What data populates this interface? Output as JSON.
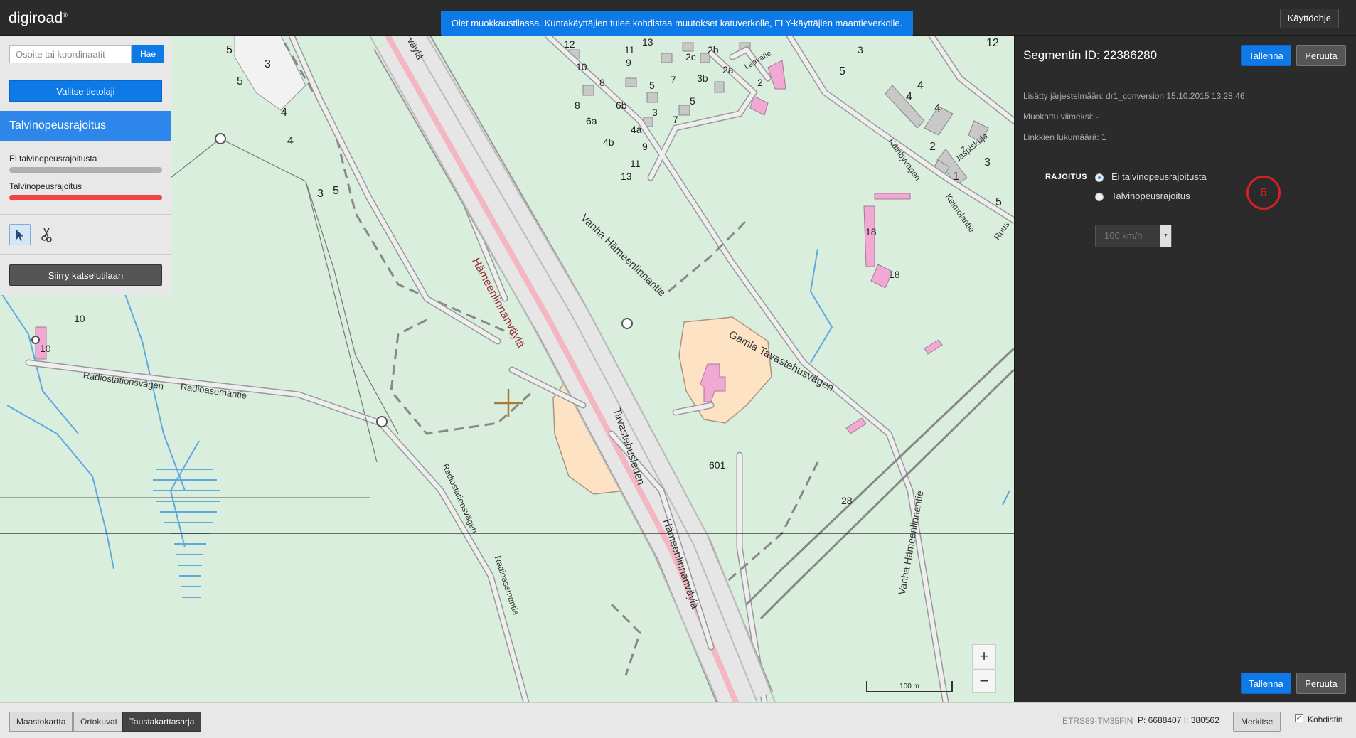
{
  "app": {
    "logo": "digiroad",
    "logo_mark": "®"
  },
  "header": {
    "notice": "Olet muokkaustilassa. Kuntakäyttäjien tulee kohdistaa muutokset katuverkolle, ELY-käyttäjien maantieverkolle.",
    "help_label": "Käyttöohje"
  },
  "search": {
    "placeholder": "Osoite tai koordinaatit",
    "button_label": "Hae"
  },
  "layer_select_label": "Valitse tietolaji",
  "layer": {
    "title": "Talvinopeusrajoitus",
    "legend": [
      {
        "label": "Ei talvinopeusrajoitusta",
        "color": "#b0b0b0"
      },
      {
        "label": "Talvinopeusrajoitus",
        "color": "#ee4444"
      }
    ]
  },
  "tools": {
    "select": "select-icon",
    "cut": "scissors-icon"
  },
  "view_mode_label": "Siirry katselutilaan",
  "segment": {
    "title": "Segmentin ID: 22386280",
    "save_label": "Tallenna",
    "cancel_label": "Peruuta",
    "added": "Lisätty järjestelmään: dr1_conversion 15.10.2015 13:28:46",
    "modified": "Muokattu viimeksi: -",
    "links": "Linkkien lukumäärä: 1",
    "restriction_label": "RAJOITUS",
    "options": [
      "Ei talvinopeusrajoitusta",
      "Talvinopeusrajoitus"
    ],
    "selected_option": 0,
    "speed_value": "100 km/h",
    "step_marker": "6"
  },
  "map": {
    "zoom_in": "+",
    "zoom_out": "−",
    "scale_label": "100 m",
    "street_labels": {
      "hameenlinnanvayla": "Hämeenlinnanväylä",
      "vanha_hameenlinnantie": "Vanha Hämeenlinnantie",
      "gamla_tavastehusvagen": "Gamla Tavastehusvägen",
      "tavastehusleden": "Tavastehusleden",
      "hameenlinnanvayla2": "Hämeenlinnanväylä",
      "radiostationsvagen": "Radiostationsvägen",
      "radioasemantie": "Radioasemantie",
      "radiostationsvagen2": "Radiostationsvägen",
      "radioasemantie2": "Radioasemantie",
      "kainbyvagen": "Käinbyvägen",
      "keimolantie": "Keimolantie",
      "jaspiskuja": "Jaspiskuja",
      "laavatie": "Laavatie",
      "vanha_hameenlinnantie2": "Vanha Hämeenlinnantie",
      "vayla_top": "väylä",
      "ruus": "Ruus"
    },
    "numbers": {
      "n601": "601",
      "n28": "28",
      "n18a": "18",
      "n18b": "18",
      "n10a": "10",
      "n10b": "10",
      "n3": "3",
      "n5a": "5",
      "n5b": "5",
      "n4a": "4",
      "n4b": "4",
      "n3b": "3",
      "n5c": "5",
      "n12a": "12",
      "n13": "13",
      "n10c": "10",
      "n11": "11",
      "n9": "9",
      "n2c": "2c",
      "n2b": "2b",
      "n8": "8",
      "n5d": "5",
      "n7": "7",
      "n3bb": "3b",
      "n2a": "2a",
      "n2": "2",
      "n8b": "8",
      "n6b": "6b",
      "n3c": "3",
      "n5e": "5",
      "n6a": "6a",
      "n4a2": "4a",
      "n4b2": "4b",
      "n7b": "7",
      "n9b": "9",
      "n11b": "11",
      "n13b": "13",
      "n12b": "12",
      "n3d": "3",
      "n5f": "5",
      "n4c": "4",
      "n4d": "4",
      "n4e": "4",
      "n2d": "2",
      "n1a": "1",
      "n3e": "3",
      "n1b": "1",
      "n5g": "5"
    }
  },
  "bottom": {
    "basemaps": [
      "Maastokartta",
      "Ortokuvat",
      "Taustakarttasarja"
    ],
    "active_basemap": 2,
    "coord_system": "ETRS89-TM35FIN",
    "coords": "P: 6688407  I: 380562",
    "mark_label": "Merkitse",
    "crosshair_label": "Kohdistin",
    "crosshair_checked": "✓"
  }
}
